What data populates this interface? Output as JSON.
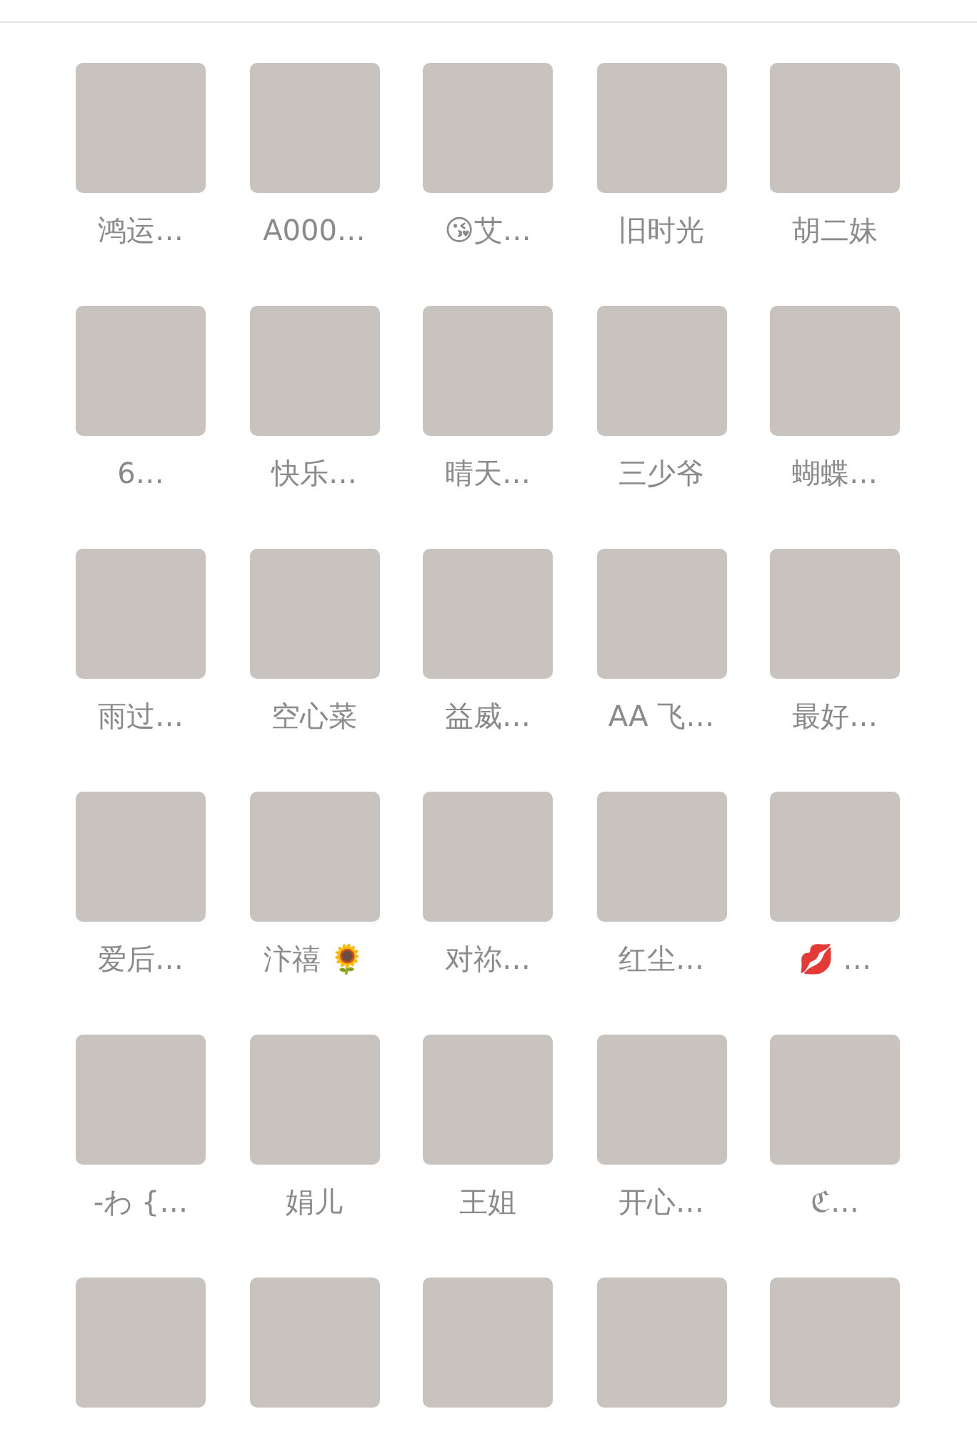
{
  "members": [
    {
      "kind": "photo",
      "name": "鸿运…"
    },
    {
      "kind": "photo",
      "name": "A000…"
    },
    {
      "kind": "photo",
      "name": "😘艾…"
    },
    {
      "kind": "photo",
      "name": "旧时光"
    },
    {
      "kind": "photo",
      "name": "胡二妹"
    },
    {
      "kind": "photo",
      "name": "6…"
    },
    {
      "kind": "photo",
      "name": "快乐…"
    },
    {
      "kind": "photo",
      "name": "晴天…"
    },
    {
      "kind": "photo",
      "name": "三少爷"
    },
    {
      "kind": "photo",
      "name": "蝴蝶…"
    },
    {
      "kind": "photo",
      "name": "雨过…"
    },
    {
      "kind": "photo",
      "name": "空心菜"
    },
    {
      "kind": "photo",
      "name": "益威…"
    },
    {
      "kind": "photo",
      "name": "AA 飞…"
    },
    {
      "kind": "photo",
      "name": "最好…"
    },
    {
      "kind": "photo",
      "name": "爱后…"
    },
    {
      "kind": "photo",
      "name": "汴禧 🌻"
    },
    {
      "kind": "photo",
      "name": "对祢…"
    },
    {
      "kind": "photo",
      "name": "红尘…"
    },
    {
      "kind": "photo",
      "name": "💋 …"
    },
    {
      "kind": "photo",
      "name": "-わ {…"
    },
    {
      "kind": "photo",
      "name": "娟儿"
    },
    {
      "kind": "photo",
      "name": "王姐"
    },
    {
      "kind": "photo",
      "name": "开心…"
    },
    {
      "kind": "photo",
      "name": "ℭ…"
    },
    {
      "kind": "photo"
    },
    {
      "kind": "photo"
    },
    {
      "kind": "photo"
    },
    {
      "kind": "photo"
    },
    {
      "kind": "photo"
    }
  ]
}
